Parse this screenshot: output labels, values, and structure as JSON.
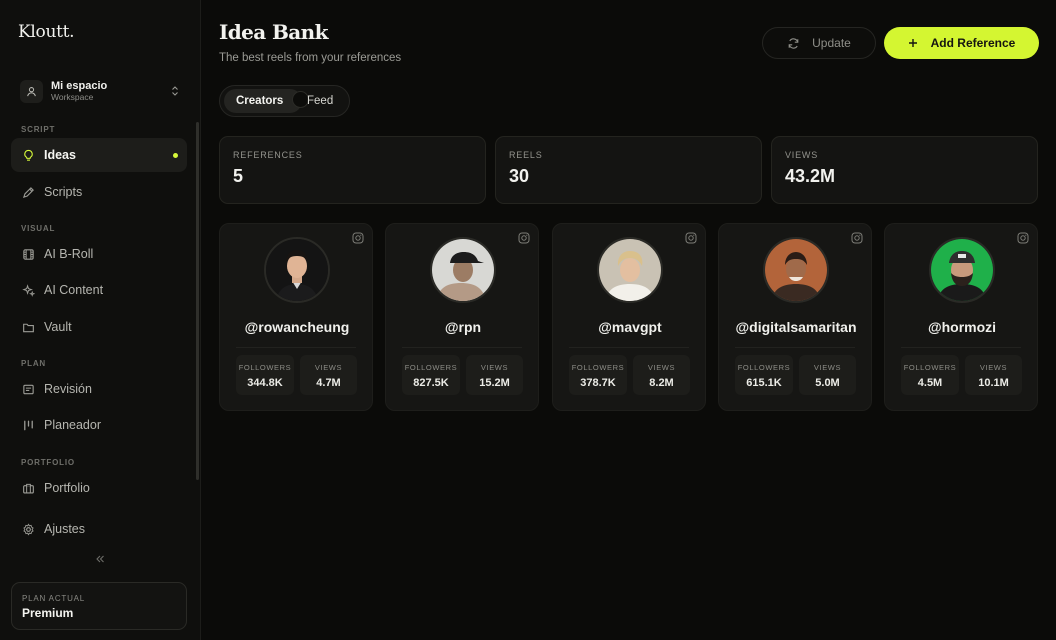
{
  "app": {
    "logo": "Kloutt."
  },
  "workspace": {
    "name": "Mi espacio",
    "subtitle": "Workspace"
  },
  "sidebar": {
    "sections": {
      "script": "SCRIPT",
      "visual": "VISUAL",
      "plan": "PLAN",
      "portfolio": "PORTFOLIO"
    },
    "items": [
      {
        "label": "Ideas",
        "icon": "lightbulb-icon",
        "active": true
      },
      {
        "label": "Scripts",
        "icon": "pen-icon"
      },
      {
        "label": "AI B-Roll",
        "icon": "film-icon"
      },
      {
        "label": "AI Content",
        "icon": "sparkles-icon"
      },
      {
        "label": "Vault",
        "icon": "folder-icon"
      },
      {
        "label": "Revisión",
        "icon": "review-icon"
      },
      {
        "label": "Planeador",
        "icon": "kanban-icon"
      },
      {
        "label": "Portfolio",
        "icon": "briefcase-icon"
      },
      {
        "label": "Ajustes",
        "icon": "gear-icon"
      }
    ],
    "plan": {
      "label": "PLAN ACTUAL",
      "value": "Premium"
    }
  },
  "header": {
    "title": "Idea Bank",
    "subtitle": "The best reels from your references",
    "update_label": "Update",
    "add_label": "Add Reference"
  },
  "toggle": {
    "creators": "Creators",
    "feed": "Feed",
    "selected": "Creators"
  },
  "stats": [
    {
      "label": "REFERENCES",
      "value": "5"
    },
    {
      "label": "REELS",
      "value": "30"
    },
    {
      "label": "VIEWS",
      "value": "43.2M"
    }
  ],
  "creators": [
    {
      "handle": "@rowancheung",
      "followers_label": "FOLLOWERS",
      "followers": "344.8K",
      "views_label": "VIEWS",
      "views": "4.7M"
    },
    {
      "handle": "@rpn",
      "followers_label": "FOLLOWERS",
      "followers": "827.5K",
      "views_label": "VIEWS",
      "views": "15.2M"
    },
    {
      "handle": "@mavgpt",
      "followers_label": "FOLLOWERS",
      "followers": "378.7K",
      "views_label": "VIEWS",
      "views": "8.2M"
    },
    {
      "handle": "@digitalsamaritan",
      "followers_label": "FOLLOWERS",
      "followers": "615.1K",
      "views_label": "VIEWS",
      "views": "5.0M"
    },
    {
      "handle": "@hormozi",
      "followers_label": "FOLLOWERS",
      "followers": "4.5M",
      "views_label": "VIEWS",
      "views": "10.1M"
    }
  ],
  "colors": {
    "accent": "#d4f631",
    "background": "#0b0b09",
    "card": "#161614"
  }
}
